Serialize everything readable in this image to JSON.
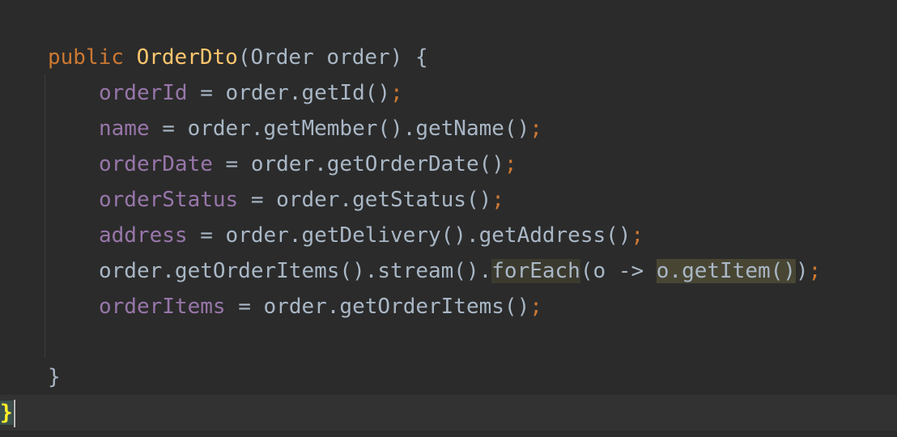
{
  "editor": {
    "lines": {
      "l1": {
        "keyword": "public",
        "name": "OrderDto",
        "params": "(Order order) {"
      },
      "l2": {
        "field": "orderId",
        "rest": " = order.getId()",
        "semi": ";"
      },
      "l3": {
        "field": "name",
        "rest": " = order.getMember().getName()",
        "semi": ";"
      },
      "l4": {
        "field": "orderDate",
        "rest": " = order.getOrderDate()",
        "semi": ";"
      },
      "l5": {
        "field": "orderStatus",
        "rest": " = order.getStatus()",
        "semi": ";"
      },
      "l6": {
        "field": "address",
        "rest": " = order.getDelivery().getAddress()",
        "semi": ";"
      },
      "l7": {
        "pre": "order.getOrderItems().stream().",
        "hl1": "forEach",
        "mid": "(o -> ",
        "hl2": "o.getItem()",
        "post": ")",
        "semi": ";"
      },
      "l8": {
        "field": "orderItems",
        "rest": " = order.getOrderItems()",
        "semi": ";"
      },
      "l9": {
        "close": "}"
      },
      "l10": {
        "brace": "}"
      }
    },
    "colors": {
      "background": "#2b2b2b",
      "keyword": "#cc7832",
      "method": "#ffc66d",
      "field": "#9876aa",
      "text": "#a9b7c6"
    }
  }
}
